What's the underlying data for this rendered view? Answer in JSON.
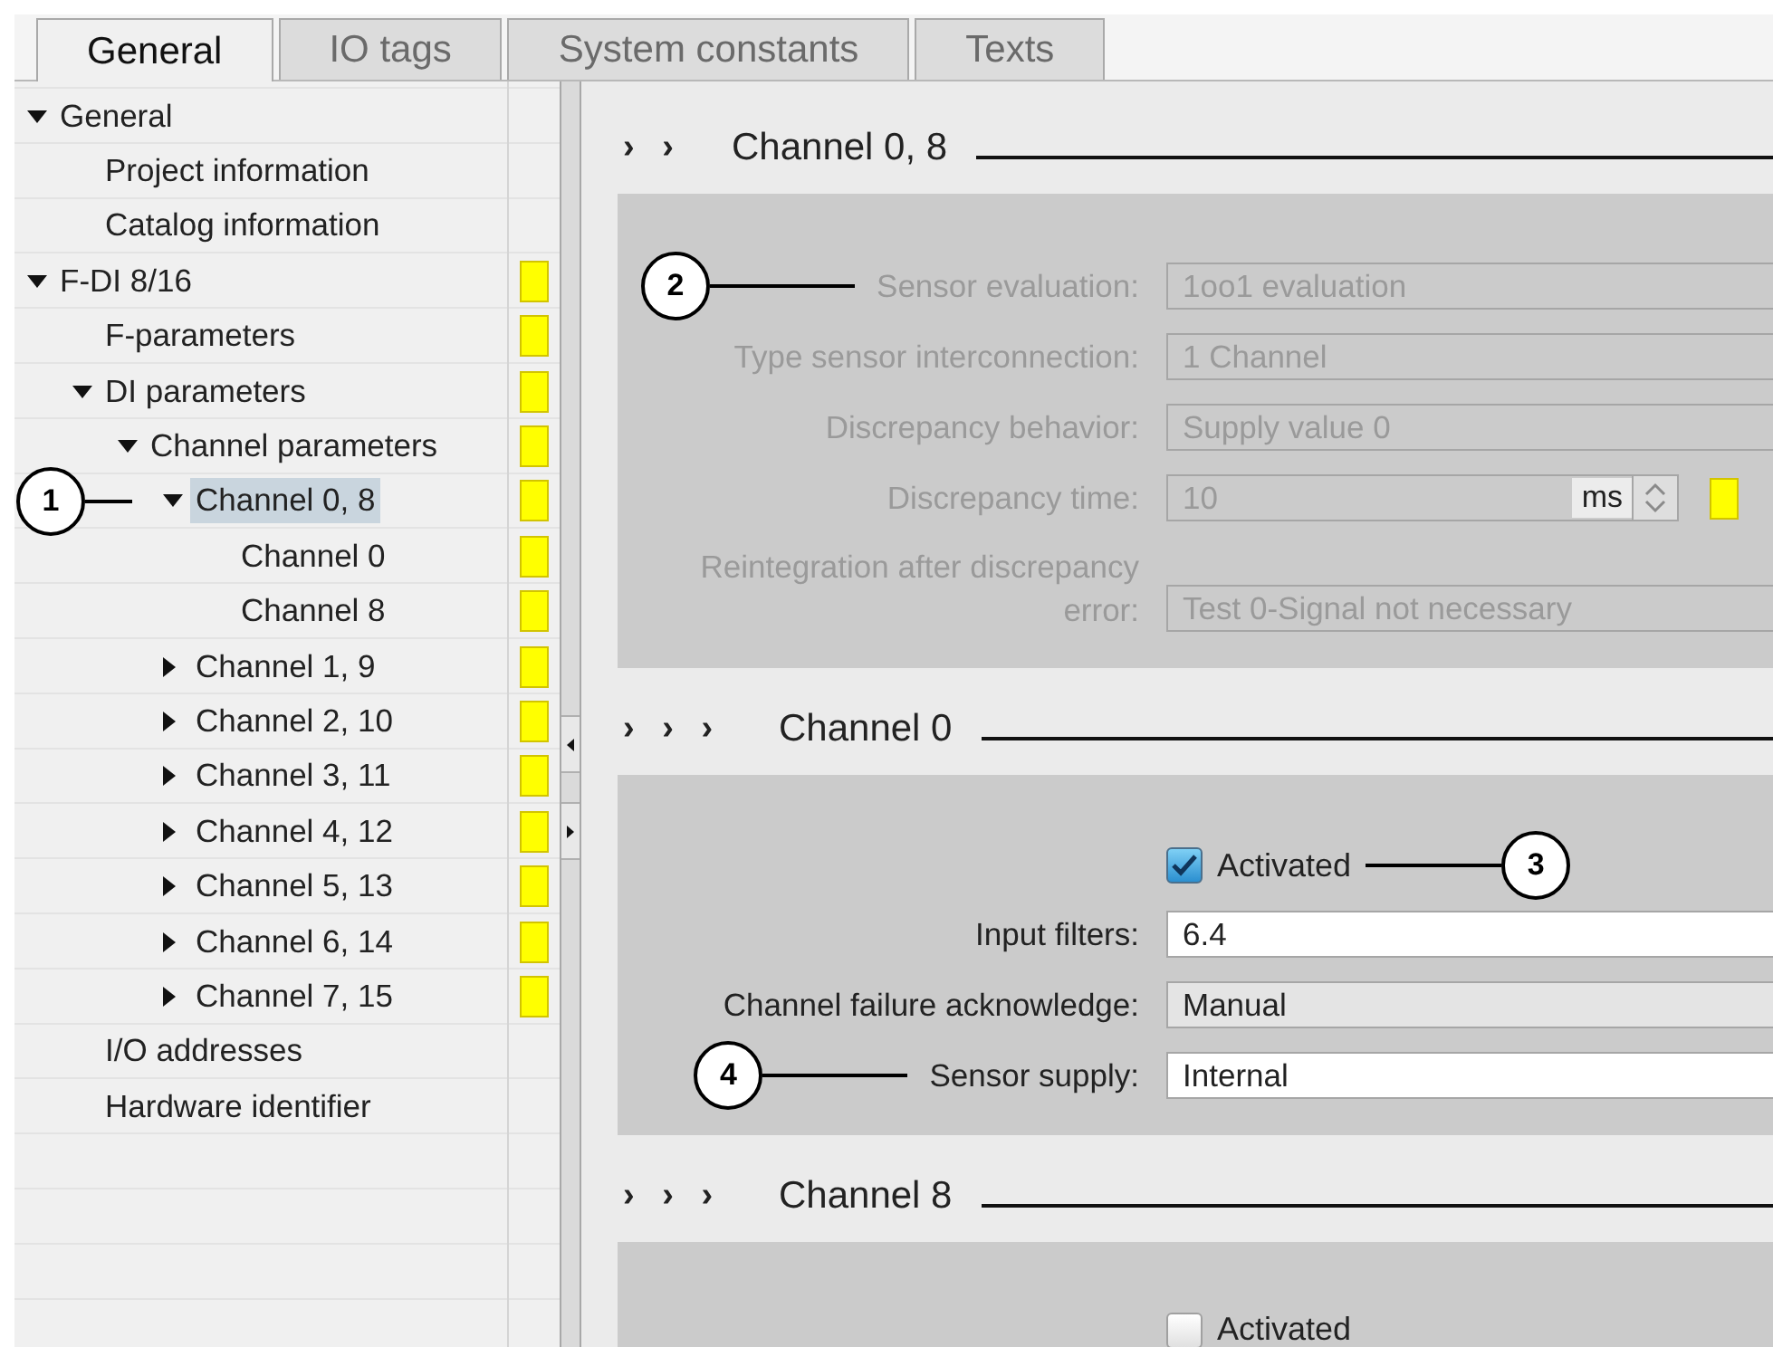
{
  "tabs": [
    {
      "label": "General",
      "selected": true
    },
    {
      "label": "IO tags",
      "selected": false
    },
    {
      "label": "System constants",
      "selected": false
    },
    {
      "label": "Texts",
      "selected": false
    }
  ],
  "tree": [
    {
      "label": "General",
      "expanded": true,
      "selected": false,
      "marked": false,
      "children": [
        {
          "label": "Project information",
          "selected": false,
          "marked": false
        },
        {
          "label": "Catalog information",
          "selected": false,
          "marked": false
        }
      ]
    },
    {
      "label": "F-DI 8/16",
      "expanded": true,
      "selected": false,
      "marked": true,
      "children": [
        {
          "label": "F-parameters",
          "selected": false,
          "marked": true
        },
        {
          "label": "DI parameters",
          "expanded": true,
          "selected": false,
          "marked": true,
          "children": [
            {
              "label": "Channel parameters",
              "expanded": true,
              "selected": false,
              "marked": true,
              "children": [
                {
                  "label": "Channel 0, 8",
                  "expanded": true,
                  "selected": true,
                  "marked": true,
                  "callout": "1",
                  "children": [
                    {
                      "label": "Channel 0",
                      "selected": false,
                      "marked": true
                    },
                    {
                      "label": "Channel 8",
                      "selected": false,
                      "marked": true
                    }
                  ]
                },
                {
                  "label": "Channel 1, 9",
                  "expanded": false,
                  "selected": false,
                  "marked": true
                },
                {
                  "label": "Channel 2, 10",
                  "expanded": false,
                  "selected": false,
                  "marked": true
                },
                {
                  "label": "Channel 3, 11",
                  "expanded": false,
                  "selected": false,
                  "marked": true
                },
                {
                  "label": "Channel 4, 12",
                  "expanded": false,
                  "selected": false,
                  "marked": true
                },
                {
                  "label": "Channel 5, 13",
                  "expanded": false,
                  "selected": false,
                  "marked": true
                },
                {
                  "label": "Channel 6, 14",
                  "expanded": false,
                  "selected": false,
                  "marked": true
                },
                {
                  "label": "Channel 7, 15",
                  "expanded": false,
                  "selected": false,
                  "marked": true
                }
              ]
            }
          ]
        },
        {
          "label": "I/O addresses",
          "selected": false,
          "marked": false
        },
        {
          "label": "Hardware identifier",
          "selected": false,
          "marked": false
        }
      ]
    }
  ],
  "sections": [
    {
      "marker": "› ›",
      "title": "Channel 0, 8",
      "fields": [
        {
          "kind": "text",
          "label": "Sensor evaluation:",
          "value": "1oo1 evaluation",
          "disabled": true,
          "callout": "2"
        },
        {
          "kind": "text",
          "label": "Type sensor interconnection:",
          "value": "1 Channel",
          "disabled": true
        },
        {
          "kind": "text",
          "label": "Discrepancy behavior:",
          "value": "Supply value 0",
          "disabled": true
        },
        {
          "kind": "spin",
          "label": "Discrepancy time:",
          "value": "10",
          "unit": "ms",
          "disabled": true,
          "marked": true
        },
        {
          "kind": "text",
          "label": "Reintegration after discrepancy error:",
          "value": "Test 0-Signal not necessary",
          "disabled": true
        }
      ]
    },
    {
      "marker": "› › ›",
      "title": "Channel 0",
      "fields": [
        {
          "kind": "checkbox",
          "label": "Activated",
          "checked": true,
          "callout": "3"
        },
        {
          "kind": "text",
          "label": "Input filters:",
          "value": "6.4",
          "disabled": false,
          "readonly": false
        },
        {
          "kind": "text",
          "label": "Channel failure acknowledge:",
          "value": "Manual",
          "disabled": false,
          "readonly": true
        },
        {
          "kind": "text",
          "label": "Sensor supply:",
          "value": "Internal",
          "disabled": false,
          "readonly": false,
          "callout": "4"
        }
      ]
    },
    {
      "marker": "› › ›",
      "title": "Channel 8",
      "fields": [
        {
          "kind": "checkbox",
          "label": "Activated",
          "checked": false
        }
      ]
    }
  ]
}
